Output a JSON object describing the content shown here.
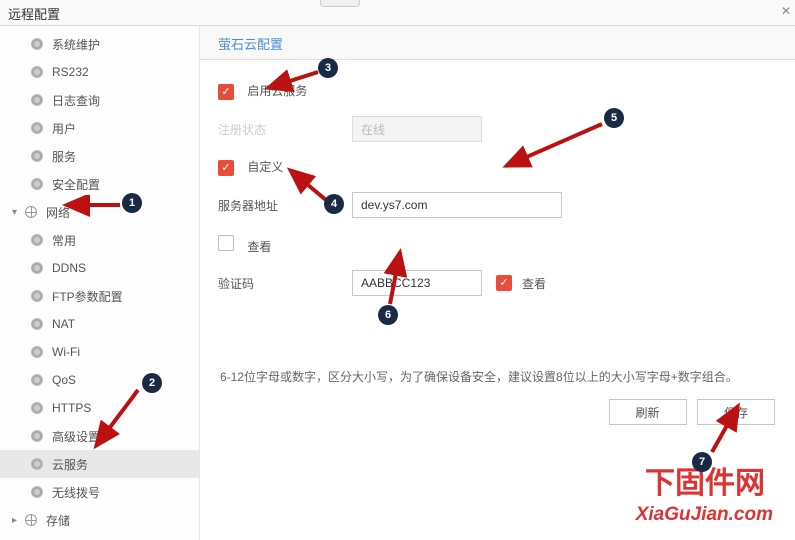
{
  "window": {
    "title": "远程配置"
  },
  "sidebar": {
    "items": [
      {
        "label": "系统维护"
      },
      {
        "label": "RS232"
      },
      {
        "label": "日志查询"
      },
      {
        "label": "用户"
      },
      {
        "label": "服务"
      },
      {
        "label": "安全配置"
      },
      {
        "label": "网络"
      },
      {
        "label": "常用"
      },
      {
        "label": "DDNS"
      },
      {
        "label": "FTP参数配置"
      },
      {
        "label": "NAT"
      },
      {
        "label": "Wi-Fi"
      },
      {
        "label": "QoS"
      },
      {
        "label": "HTTPS"
      },
      {
        "label": "高级设置"
      },
      {
        "label": "云服务"
      },
      {
        "label": "无线拨号"
      },
      {
        "label": "存储"
      }
    ]
  },
  "page": {
    "heading": "萤石云配置",
    "enable_label": "启用云服务",
    "reg_status_label": "注册状态",
    "reg_status_value": "在线",
    "custom_label": "自定义",
    "server_label": "服务器地址",
    "server_value": "dev.ys7.com",
    "view_label": "查看",
    "verify_label": "验证码",
    "verify_value": "AABBCC123",
    "view2_label": "查看",
    "help": "6-12位字母或数字，区分大小写，为了确保设备安全，建议设置8位以上的大小写字母+数字组合。",
    "refresh": "刷新",
    "save": "保存"
  },
  "markers": {
    "m1": "1",
    "m2": "2",
    "m3": "3",
    "m4": "4",
    "m5": "5",
    "m6": "6",
    "m7": "7"
  },
  "watermark": {
    "cn": "下固件网",
    "en": "XiaGuJian.com"
  }
}
